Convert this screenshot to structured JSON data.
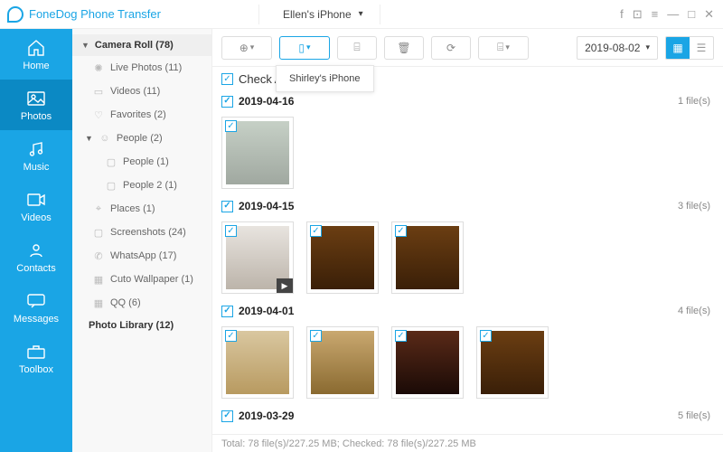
{
  "app": {
    "title": "FoneDog Phone Transfer"
  },
  "device": {
    "name": "Ellen's iPhone"
  },
  "nav": {
    "items": [
      {
        "label": "Home"
      },
      {
        "label": "Photos"
      },
      {
        "label": "Music"
      },
      {
        "label": "Videos"
      },
      {
        "label": "Contacts"
      },
      {
        "label": "Messages"
      },
      {
        "label": "Toolbox"
      }
    ],
    "active": "Photos"
  },
  "sidebar": {
    "root": {
      "label": "Camera Roll (78)"
    },
    "items": [
      {
        "label": "Live Photos (11)",
        "icon": "✦"
      },
      {
        "label": "Videos (11)",
        "icon": "▭"
      },
      {
        "label": "Favorites (2)",
        "icon": "♡"
      }
    ],
    "people": {
      "label": "People (2)",
      "children": [
        {
          "label": "People (1)"
        },
        {
          "label": "People 2 (1)"
        }
      ]
    },
    "items2": [
      {
        "label": "Places (1)",
        "icon": "⌖"
      },
      {
        "label": "Screenshots (24)",
        "icon": "▢"
      },
      {
        "label": "WhatsApp (17)",
        "icon": "✆"
      },
      {
        "label": "Cuto Wallpaper (1)",
        "icon": "▦"
      },
      {
        "label": "QQ (6)",
        "icon": "▦"
      }
    ],
    "library": {
      "label": "Photo Library (12)"
    }
  },
  "toolbar": {
    "tooltip": "Shirley's iPhone",
    "date": "2019-08-02"
  },
  "content": {
    "check_all": "Check All(78)",
    "groups": [
      {
        "date": "2019-04-16",
        "files": "1 file(s)",
        "thumbs": 1,
        "video": []
      },
      {
        "date": "2019-04-15",
        "files": "3 file(s)",
        "thumbs": 3,
        "video": [
          0
        ]
      },
      {
        "date": "2019-04-01",
        "files": "4 file(s)",
        "thumbs": 4,
        "video": []
      },
      {
        "date": "2019-03-29",
        "files": "5 file(s)",
        "thumbs": 0,
        "video": []
      }
    ]
  },
  "footer": {
    "status": "Total: 78 file(s)/227.25 MB; Checked: 78 file(s)/227.25 MB"
  }
}
